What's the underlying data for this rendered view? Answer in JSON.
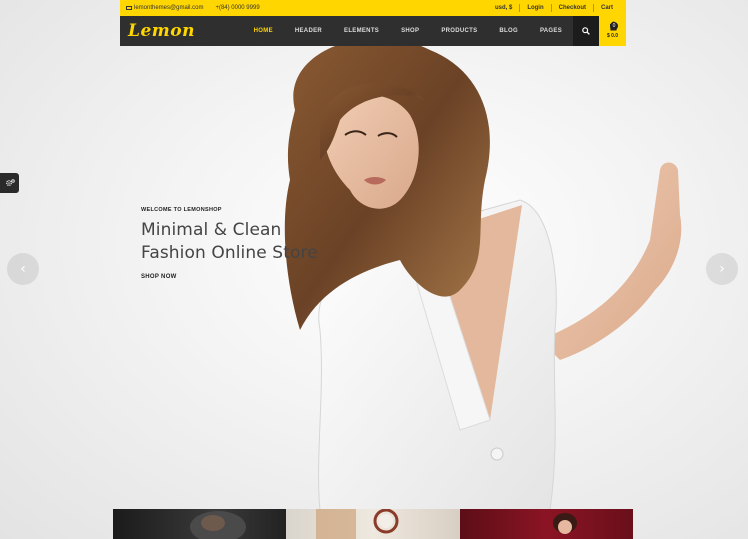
{
  "topbar": {
    "email": "lemonthemes@gmail.com",
    "phone": "+(84) 0000 9999",
    "currency": "usd, $",
    "login": "Login",
    "checkout": "Checkout",
    "cart": "Cart"
  },
  "navbar": {
    "logo": "Lemon",
    "items": [
      {
        "label": "HOME",
        "active": true
      },
      {
        "label": "HEADER"
      },
      {
        "label": "ELEMENTS"
      },
      {
        "label": "SHOP"
      },
      {
        "label": "PRODUCTS"
      },
      {
        "label": "BLOG"
      },
      {
        "label": "PAGES"
      }
    ],
    "cart_count": "0",
    "cart_total": "$ 0.0"
  },
  "hero": {
    "welcome": "WELCOME TO LEMONSHOP",
    "headline_line1": "Minimal & Clean",
    "headline_line2": "Fashion Online Store",
    "cta": "SHOP NOW"
  },
  "icons": {
    "search": "search-icon",
    "cart": "shopping-bag-icon",
    "settings": "gear-icon",
    "prev": "chevron-left-icon",
    "next": "chevron-right-icon",
    "mail": "mail-icon"
  },
  "colors": {
    "accent": "#ffd600",
    "nav_bg": "#2f2f2f"
  }
}
